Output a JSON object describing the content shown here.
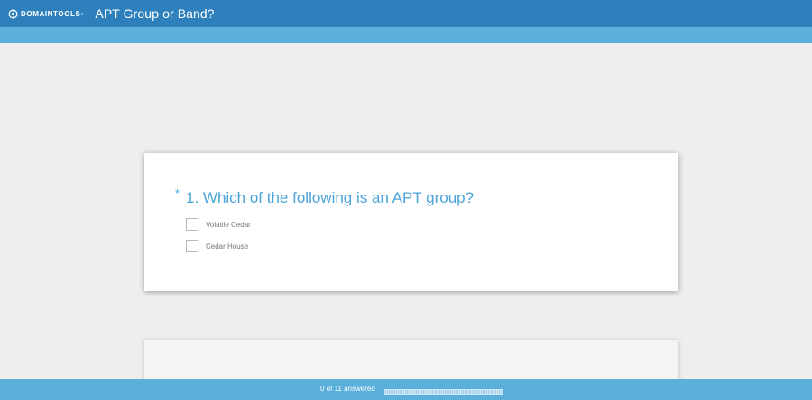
{
  "header": {
    "logo_text": "DOMAINTOOLS",
    "logo_tm": "®",
    "title": "APT Group or Band?",
    "color": "#2d80bb"
  },
  "subbar": {
    "color": "#5aafdb"
  },
  "question": {
    "required_mark": "*",
    "text": "1. Which of the following is an APT group?",
    "options": [
      {
        "label": "Volatile Cedar",
        "checked": false
      },
      {
        "label": "Cedar House",
        "checked": false
      }
    ]
  },
  "footer": {
    "progress_text": "0 of 11 answered",
    "answered": 0,
    "total": 11
  },
  "colors": {
    "accent": "#4aa3d9",
    "background": "#eeeeee"
  }
}
